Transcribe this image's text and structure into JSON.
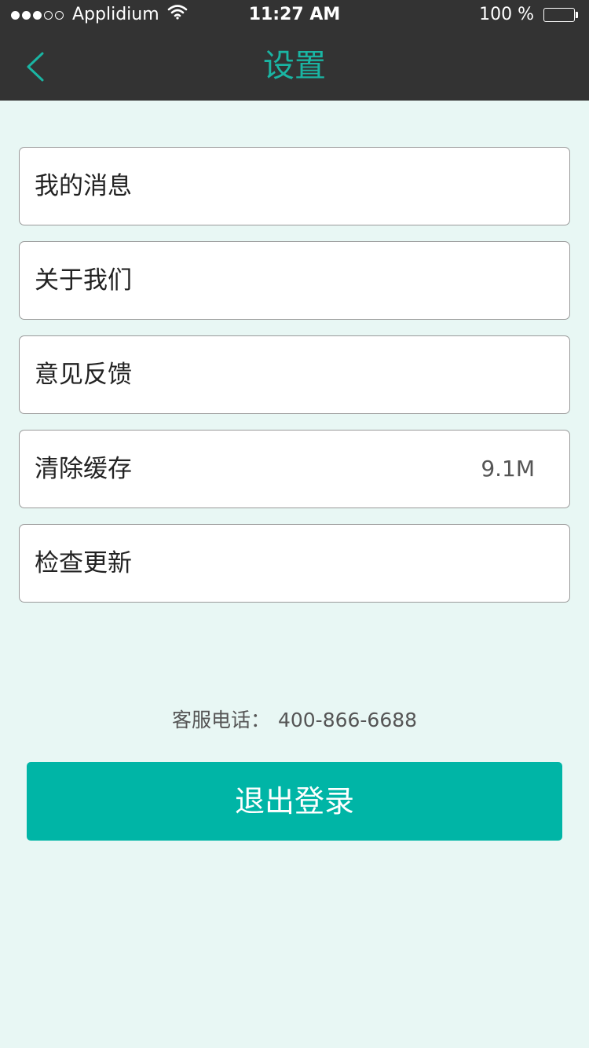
{
  "status_bar": {
    "carrier": "Applidium",
    "time": "11:27 AM",
    "battery": "100 %",
    "signal_bars_filled": 3,
    "signal_bars_total": 5
  },
  "nav": {
    "title": "设置",
    "back_icon": "chevron-left-icon"
  },
  "menu": {
    "items": [
      {
        "label": "我的消息",
        "value": ""
      },
      {
        "label": "关于我们",
        "value": ""
      },
      {
        "label": "意见反馈",
        "value": ""
      },
      {
        "label": "清除缓存",
        "value": "9.1M"
      },
      {
        "label": "检查更新",
        "value": ""
      }
    ]
  },
  "footer": {
    "hotline_label": "客服电话：",
    "hotline_number": "400-866-6688",
    "logout_label": "退出登录"
  },
  "colors": {
    "accent": "#00b5a6",
    "nav_bg": "#333333",
    "page_bg": "#e8f7f4"
  }
}
